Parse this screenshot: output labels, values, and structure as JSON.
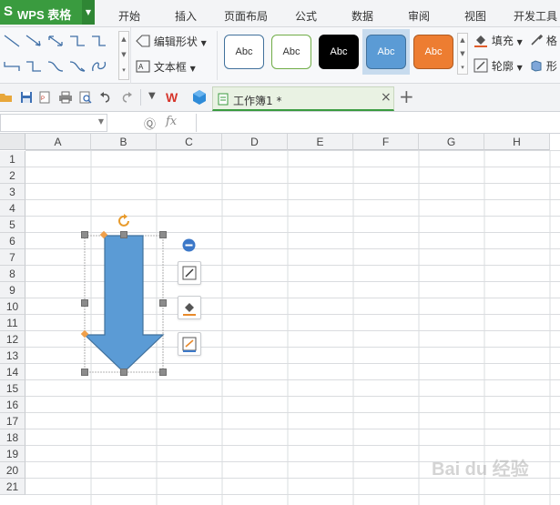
{
  "app": {
    "logo_mark": "S",
    "logo_text": "WPS 表格"
  },
  "menu": {
    "tabs": [
      "开始",
      "插入",
      "页面布局",
      "公式",
      "数据",
      "审阅",
      "视图",
      "开发工具"
    ]
  },
  "ribbon": {
    "edit_shape_label": "编辑形状",
    "textbox_label": "文本框",
    "style_sample_text": "Abc",
    "fill_label": "填充",
    "outline_label": "轮廓",
    "format_label": "格",
    "shape_effect_label": "形"
  },
  "document_tab": {
    "title": "工作簿1 *",
    "close_glyph": "×",
    "new_tab_glyph": "+"
  },
  "formula_bar": {
    "fx_label": "fx",
    "zoom_glyph": "Ⓠ"
  },
  "sheet": {
    "columns": [
      "A",
      "B",
      "C",
      "D",
      "E",
      "F",
      "G",
      "H"
    ],
    "rows": [
      "1",
      "2",
      "3",
      "4",
      "5",
      "6",
      "7",
      "8",
      "9",
      "10",
      "11",
      "12",
      "13",
      "14",
      "15",
      "16",
      "17",
      "18",
      "19",
      "20",
      "21"
    ]
  },
  "colors": {
    "brand_green": "#3a9b3f",
    "shape_fill": "#5b9bd5",
    "shape_stroke": "#41719c",
    "style_selected": "#5b9bd5",
    "style_orange": "#ed7d31"
  },
  "watermark": {
    "text": "Bai du 经验"
  }
}
